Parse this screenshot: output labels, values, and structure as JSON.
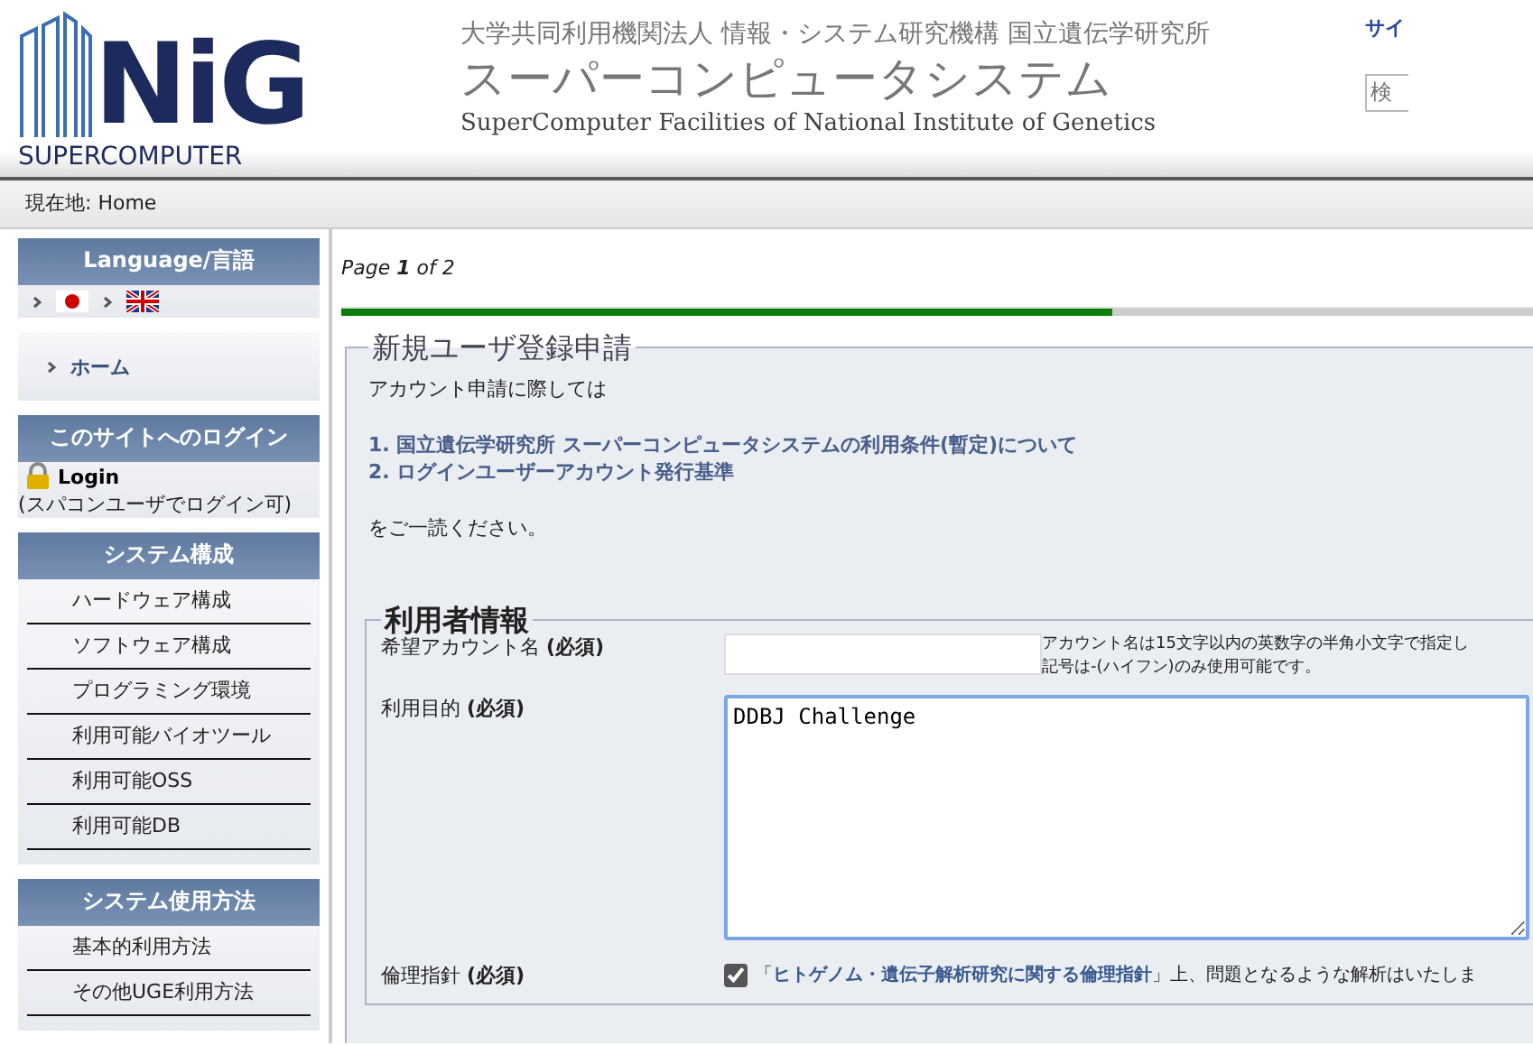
{
  "header": {
    "logo_text": "NiG",
    "logo_subtitle": "SUPERCOMPUTER",
    "org_line": "大学共同利用機関法人 情報・システム研究機構 国立遺伝学研究所",
    "title": "スーパーコンピュータシステム",
    "subtitle": "SuperComputer Facilities of National Institute of Genetics",
    "right_link": "サイ",
    "search": {
      "placeholder": "検"
    }
  },
  "breadcrumb": {
    "label": "現在地:",
    "current": "Home"
  },
  "sidebar": {
    "language": {
      "title": "Language/言語",
      "flags": [
        {
          "kind": "japan"
        },
        {
          "kind": "uk"
        }
      ]
    },
    "home_link": "ホーム",
    "login": {
      "title": "このサイトへのログイン",
      "link": "Login",
      "note": "(スパコンユーザでログイン可)"
    },
    "sections": [
      {
        "title": "システム構成",
        "items": [
          "ハードウェア構成",
          "ソフトウェア構成",
          "プログラミング環境",
          "利用可能バイオツール",
          "利用可能OSS",
          "利用可能DB"
        ]
      },
      {
        "title": "システム使用方法",
        "items": [
          "基本的利用方法",
          "その他UGE利用方法"
        ]
      }
    ]
  },
  "main": {
    "page_indicator": "Page **1** of 2",
    "progress": {
      "level": 0.61
    },
    "form": {
      "legend": "新規ユーザ登録申請",
      "intro": "アカウント申請に際しては",
      "links": [
        "1. 国立遺伝学研究所 スーパーコンピュータシステムの利用条件(暫定)について",
        "2. ログインユーザーアカウント発行基準"
      ],
      "outro": "をご一読ください。",
      "user_info": {
        "legend": "利用者情報",
        "fields": [
          {
            "kind": "text",
            "label": "希望アカウント名 **(必須)**",
            "hint": [
              "アカウント名は15文字以内の英数字の半角小文字で指定し",
              "記号は-(ハイフン)のみ使用可能です。"
            ]
          },
          {
            "kind": "textarea",
            "label": "利用目的 **(必須)**",
            "value": "DDBJ Challenge"
          },
          {
            "kind": "checkbox",
            "label": "倫理指針 **(必須)**",
            "checked": true,
            "text": "「**ヒトゲノム・遺伝子解析研究に関する倫理指針**」上、問題となるような解析はいたしま"
          }
        ]
      }
    }
  }
}
